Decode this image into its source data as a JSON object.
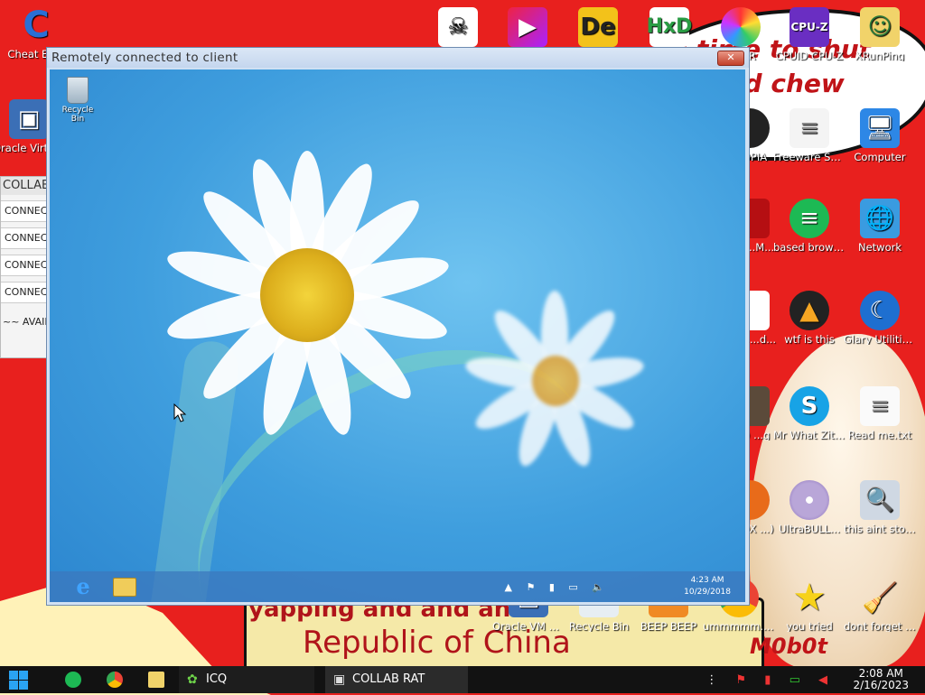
{
  "wallpaper": {
    "cloud_text": "is time to shut up and chew billing",
    "banner_top": "yapping and and and",
    "banner_bottom": "Republic of China",
    "cone_text": "M0b0t"
  },
  "desktop_icons": [
    {
      "label": "Cheat En..."
    },
    {
      "label": "Oracle VirtualBox"
    },
    {
      "label": "CPUID CPU-Z"
    },
    {
      "label": "XRunPing"
    },
    {
      "label": "...SER"
    },
    {
      "label": "...OPIA"
    },
    {
      "label": "Freeware Sys Note..."
    },
    {
      "label": "Computer"
    },
    {
      "label": "...A ...M..."
    },
    {
      "label": "based browser ..."
    },
    {
      "label": "Network"
    },
    {
      "label": "...an ...d..."
    },
    {
      "label": "wtf is this"
    },
    {
      "label": "Glary Utilities 4"
    },
    {
      "label": "...0) ...g"
    },
    {
      "label": "Mr What Zit Too Ya"
    },
    {
      "label": "Read me.txt"
    },
    {
      "label": "...FOX ...)"
    },
    {
      "label": "UltraBULL..."
    },
    {
      "label": "this aint stopping di..."
    },
    {
      "label": "Oracle VM Virtualbox"
    },
    {
      "label": "Recycle Bin"
    },
    {
      "label": "BEEP BEEP"
    },
    {
      "label": "ummmmm... chrome"
    },
    {
      "label": "you tried"
    },
    {
      "label": "dont forget to wash y..."
    }
  ],
  "collab_panel": {
    "header": "COLLAB R",
    "rows": [
      "CONNECT",
      "CONNECT",
      "CONNECT",
      "CONNECT"
    ],
    "avail": "~~ AVAIL"
  },
  "remote_window": {
    "title": "Remotely connected to client",
    "close_label": "✕",
    "recycle_bin": "Recycle Bin",
    "time": "4:23 AM",
    "date": "10/29/2018",
    "tray_chevron": "▲"
  },
  "taskbar": {
    "icq_label": "ICQ",
    "collab_label": "COLLAB RAT",
    "time": "2:08 AM",
    "date": "2/16/2023",
    "more_icon": "⋮"
  },
  "colors": {
    "wallpaper_red": "#e8201e",
    "taskbar": "#121212",
    "remote_sky": "#3f9ede"
  }
}
